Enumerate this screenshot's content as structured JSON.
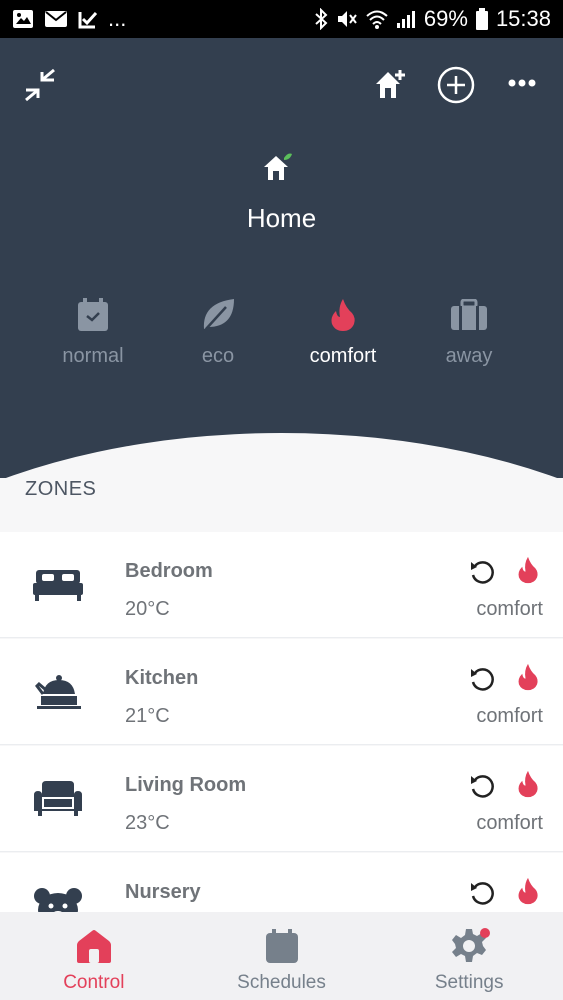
{
  "status_bar": {
    "notif_more": "...",
    "battery": "69%",
    "time": "15:38"
  },
  "header": {
    "home_title": "Home",
    "modes": [
      {
        "label": "normal",
        "icon": "calendar-icon",
        "active": false
      },
      {
        "label": "eco",
        "icon": "leaf-icon",
        "active": false
      },
      {
        "label": "comfort",
        "icon": "flame-icon",
        "active": true
      },
      {
        "label": "away",
        "icon": "suitcase-icon",
        "active": false
      }
    ]
  },
  "zones_label": "ZONES",
  "zones": [
    {
      "name": "Bedroom",
      "temp": "20°C",
      "mode": "comfort",
      "icon": "bed-icon"
    },
    {
      "name": "Kitchen",
      "temp": "21°C",
      "mode": "comfort",
      "icon": "kettle-icon"
    },
    {
      "name": "Living Room",
      "temp": "23°C",
      "mode": "comfort",
      "icon": "armchair-icon"
    },
    {
      "name": "Nursery",
      "temp": "",
      "mode": "",
      "icon": "teddy-bear-icon"
    }
  ],
  "bottom_nav": [
    {
      "label": "Control",
      "icon": "home-icon",
      "active": true
    },
    {
      "label": "Schedules",
      "icon": "calendar-icon",
      "active": false
    },
    {
      "label": "Settings",
      "icon": "gear-icon",
      "active": false
    }
  ],
  "colors": {
    "header_bg": "#333f4f",
    "accent": "#e3405a",
    "text_muted": "#6f7378"
  }
}
